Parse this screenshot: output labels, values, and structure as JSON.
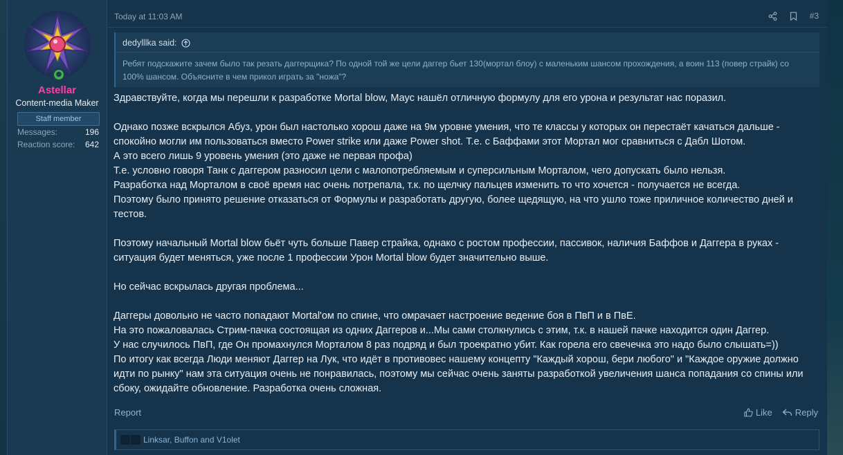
{
  "user": {
    "name": "Astellar",
    "title": "Content-media Maker",
    "badge": "Staff member",
    "stats": [
      {
        "label": "Messages:",
        "value": "196"
      },
      {
        "label": "Reaction score:",
        "value": "642"
      }
    ],
    "avatar_icon": "star-avatar-icon",
    "online_icon": "online-status-icon"
  },
  "post": {
    "date": "Today at 11:03 AM",
    "number": "#3",
    "share_icon": "share-icon",
    "bookmark_icon": "bookmark-icon"
  },
  "quote": {
    "author": "dedylllka said:",
    "body": "Ребят подскажите зачем было так резать даггерщика? По одной той же цели даггер бьет 130(мортал блоу) с маленьким шансом прохождения, а воин 113 (повер страйк) со 100% шансом. Объясните в чем прикол играть за \"ножа\"?"
  },
  "message": {
    "lines": [
      "Здравствуйте, когда мы перешли к разработке Mortal blow, Маус нашёл отличную формулу для его урона и результат нас поразил.",
      "",
      "Однако позже вскрылся Абуз, урон был настолько хорош даже на 9м уровне умения, что те классы у которых он перестаёт качаться дальше - спокойно могли им пользоваться вместо Power strike или даже Power shot. Т.е. с Баффами этот Мортал мог сравниться с Дабл Шотом.",
      "А это всего лишь 9 уровень умения (это даже не первая профа)",
      "Т.е. условно говоря Танк с даггером разносил цели с малопотребляемым и суперсильным Морталом, чего допускать было нельзя.",
      "Разработка над Морталом в своё время нас очень потрепала, т.к. по щелчку пальцев изменить то что хочется - получается не всегда.",
      "Поэтому было принято решение отказаться от Формулы и разработать другую, более щедящую, на что ушло тоже приличное количество дней и тестов.",
      "",
      "Поэтому начальный Mortal blow бьёт чуть больше Павер страйка, однако с ростом профессии, пассивок, наличия Баффов и Даггера в руках - ситуация будет меняться, уже после 1 профессии Урон Mortal blow будет значительно выше.",
      "",
      "Но сейчас вскрылась другая проблема...",
      "",
      "Даггеры довольно не часто попадают Mortal'ом по спине, что омрачает настроение ведение боя в ПвП и в ПвЕ.",
      "На это пожаловалась Стрим-пачка состоящая из одних Даггеров и...Мы сами столкнулись с этим, т.к. в нашей пачке находится один Даггер.",
      "У нас случилось ПвП, где Он промахнулся Морталом 8 раз подряд и был троекратно убит. Как горела его свечечка это надо было слышать=))",
      "По итогу как всегда Люди меняют Даггер на Лук, что идёт в противовес нашему концепту \"Каждый хорош, бери любого\" и \"Каждое оружие должно идти по рынку\" нам эта ситуация очень не понравилась, поэтому мы сейчас очень заняты разработкой увеличения шанса попадания со спины или сбоку, ожидайте обновление. Разработка очень сложная."
    ]
  },
  "footer": {
    "report": "Report",
    "like": "Like",
    "reply": "Reply"
  },
  "reactions": {
    "users": "Linksar, Buffon and V1olet"
  }
}
